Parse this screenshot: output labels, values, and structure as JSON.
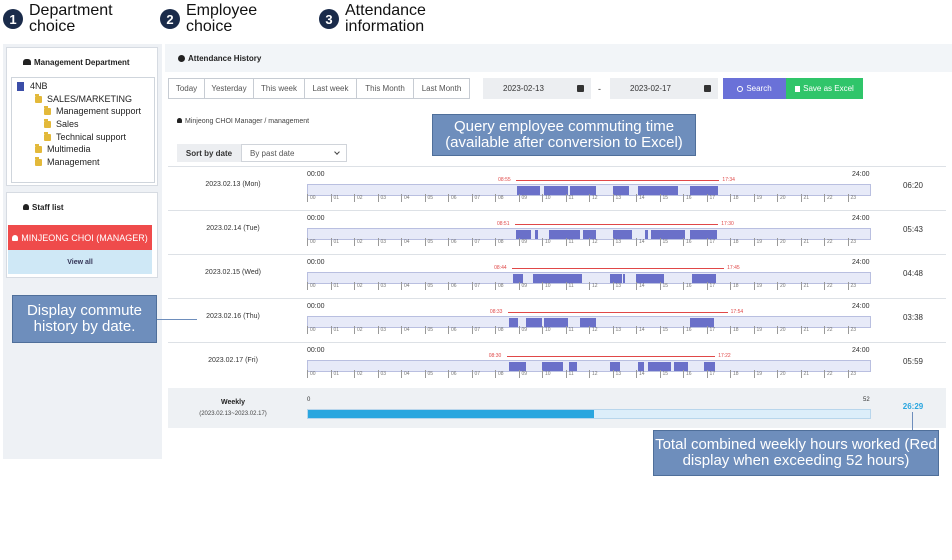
{
  "steps": [
    {
      "num": "1",
      "title": "Department choice"
    },
    {
      "num": "2",
      "title": "Employee choice"
    },
    {
      "num": "3",
      "title": "Attendance information"
    }
  ],
  "department": {
    "title": "Management Department",
    "tree": [
      {
        "label": "4NB",
        "level": 0,
        "icon": "building-icon"
      },
      {
        "label": "SALES/MARKETING",
        "level": 1,
        "icon": "folder-icon"
      },
      {
        "label": "Management support",
        "level": 2,
        "icon": "folder-icon"
      },
      {
        "label": "Sales",
        "level": 2,
        "icon": "folder-icon"
      },
      {
        "label": "Technical support",
        "level": 2,
        "icon": "folder-icon"
      },
      {
        "label": "Multimedia",
        "level": 1,
        "icon": "folder-icon"
      },
      {
        "label": "Management",
        "level": 1,
        "icon": "folder-icon"
      }
    ]
  },
  "staff": {
    "title": "Staff list",
    "selected": "MINJEONG CHOI (MANAGER)",
    "view_all": "View all"
  },
  "attendance": {
    "title": "Attendance History",
    "ranges": [
      "Today",
      "Yesterday",
      "This week",
      "Last week",
      "This Month",
      "Last Month"
    ],
    "date_from": "2023-02-13",
    "date_sep": "-",
    "date_to": "2023-02-17",
    "search": "Search",
    "excel": "Save as Excel",
    "employee": "Minjeong CHOI Manager / management",
    "sort_label": "Sort by date",
    "sort_value": "By past date",
    "axis_start": "00:00",
    "axis_end": "24:00",
    "hour_labels": [
      "00",
      "01",
      "02",
      "03",
      "04",
      "05",
      "06",
      "07",
      "08",
      "09",
      "10",
      "11",
      "12",
      "13",
      "14",
      "15",
      "16",
      "17",
      "18",
      "19",
      "20",
      "21",
      "22",
      "23"
    ],
    "days": [
      {
        "date": "2023.02.13 (Mon)",
        "in": "08:55",
        "out": "17:34",
        "in_h": 8.9,
        "out_h": 17.55,
        "total": "06:20",
        "segments": [
          [
            8.95,
            9.9
          ],
          [
            10.1,
            11.1
          ],
          [
            11.2,
            12.3
          ],
          [
            13.0,
            13.7
          ],
          [
            14.1,
            15.8
          ],
          [
            16.3,
            17.5
          ]
        ]
      },
      {
        "date": "2023.02.14 (Tue)",
        "in": "08:51",
        "out": "17:30",
        "in_h": 8.85,
        "out_h": 17.5,
        "total": "05:43",
        "segments": [
          [
            8.9,
            9.55
          ],
          [
            9.7,
            9.85
          ],
          [
            10.3,
            11.6
          ],
          [
            11.75,
            12.3
          ],
          [
            13.0,
            13.85
          ],
          [
            14.4,
            14.5
          ],
          [
            14.65,
            16.1
          ],
          [
            16.3,
            17.45
          ]
        ]
      },
      {
        "date": "2023.02.15 (Wed)",
        "in": "08:44",
        "out": "17:45",
        "in_h": 8.73,
        "out_h": 17.75,
        "total": "04:48",
        "segments": [
          [
            8.75,
            9.2
          ],
          [
            9.6,
            11.7
          ],
          [
            12.9,
            13.4
          ],
          [
            13.45,
            13.55
          ],
          [
            14.0,
            15.2
          ],
          [
            16.4,
            17.4
          ]
        ]
      },
      {
        "date": "2023.02.16 (Thu)",
        "in": "08:33",
        "out": "17:54",
        "in_h": 8.55,
        "out_h": 17.9,
        "total": "03:38",
        "segments": [
          [
            8.6,
            9.0
          ],
          [
            9.3,
            10.0
          ],
          [
            10.1,
            11.1
          ],
          [
            11.6,
            12.3
          ],
          [
            16.3,
            17.3
          ]
        ]
      },
      {
        "date": "2023.02.17 (Fri)",
        "in": "08:30",
        "out": "17:22",
        "in_h": 8.5,
        "out_h": 17.37,
        "total": "05:59",
        "segments": [
          [
            8.6,
            9.3
          ],
          [
            10.0,
            10.9
          ],
          [
            11.15,
            11.5
          ],
          [
            12.9,
            13.3
          ],
          [
            14.1,
            14.35
          ],
          [
            14.5,
            15.5
          ],
          [
            15.6,
            16.2
          ],
          [
            16.9,
            17.35
          ]
        ]
      }
    ],
    "weekly": {
      "label": "Weekly",
      "range": "(2023.02.13~2023.02.17)",
      "min": "0",
      "max": "52",
      "total": "26:29",
      "hours": 26.48,
      "max_hours": 52
    }
  },
  "callouts": {
    "query": "Query employee commuting time (available after conversion to Excel)",
    "history": "Display commute history by date.",
    "weekly": "Total combined weekly hours worked (Red display when exceeding 52 hours)"
  },
  "colors": {
    "segment": "#6a70c9",
    "redline": "#e04848",
    "selected_staff": "#ef4b4b",
    "weekly_fill": "#2aa6df",
    "callout": "#6e8ebc"
  }
}
